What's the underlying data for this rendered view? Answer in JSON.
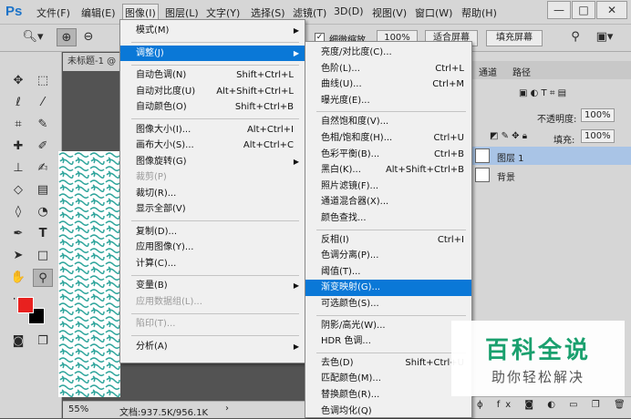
{
  "app": {
    "logo": "Ps"
  },
  "menubar": {
    "items": [
      "文件(F)",
      "编辑(E)",
      "图像(I)",
      "图层(L)",
      "文字(Y)",
      "选择(S)",
      "滤镜(T)",
      "3D(D)",
      "视图(V)",
      "窗口(W)",
      "帮助(H)"
    ],
    "active": "图像(I)"
  },
  "window": {
    "minimize": "—",
    "restore": "□",
    "close": "✕"
  },
  "options": {
    "checkbox_label": "细微缩放",
    "zoom": "100%",
    "fit_screen": "适合屏幕",
    "fill_screen": "填充屏幕"
  },
  "document": {
    "tab_title": "未标题-1 @",
    "zoom": "55%",
    "doc_size": "文档:937.5K/956.1K"
  },
  "image_menu": {
    "items": [
      {
        "label": "模式(M)",
        "sub": true
      },
      {
        "sep": true
      },
      {
        "label": "调整(J)",
        "sub": true,
        "hl": true
      },
      {
        "sep": true
      },
      {
        "label": "自动色调(N)",
        "sc": "Shift+Ctrl+L"
      },
      {
        "label": "自动对比度(U)",
        "sc": "Alt+Shift+Ctrl+L"
      },
      {
        "label": "自动颜色(O)",
        "sc": "Shift+Ctrl+B"
      },
      {
        "sep": true
      },
      {
        "label": "图像大小(I)...",
        "sc": "Alt+Ctrl+I"
      },
      {
        "label": "画布大小(S)...",
        "sc": "Alt+Ctrl+C"
      },
      {
        "label": "图像旋转(G)",
        "sub": true
      },
      {
        "label": "裁剪(P)",
        "dis": true
      },
      {
        "label": "裁切(R)..."
      },
      {
        "label": "显示全部(V)"
      },
      {
        "sep": true
      },
      {
        "label": "复制(D)..."
      },
      {
        "label": "应用图像(Y)..."
      },
      {
        "label": "计算(C)..."
      },
      {
        "sep": true
      },
      {
        "label": "变量(B)",
        "sub": true
      },
      {
        "label": "应用数据组(L)...",
        "dis": true
      },
      {
        "sep": true
      },
      {
        "label": "陷印(T)...",
        "dis": true
      },
      {
        "sep": true
      },
      {
        "label": "分析(A)",
        "sub": true
      }
    ]
  },
  "adjust_menu": {
    "items": [
      {
        "label": "亮度/对比度(C)..."
      },
      {
        "label": "色阶(L)...",
        "sc": "Ctrl+L"
      },
      {
        "label": "曲线(U)...",
        "sc": "Ctrl+M"
      },
      {
        "label": "曝光度(E)..."
      },
      {
        "sep": true
      },
      {
        "label": "自然饱和度(V)..."
      },
      {
        "label": "色相/饱和度(H)...",
        "sc": "Ctrl+U"
      },
      {
        "label": "色彩平衡(B)...",
        "sc": "Ctrl+B"
      },
      {
        "label": "黑白(K)...",
        "sc": "Alt+Shift+Ctrl+B"
      },
      {
        "label": "照片滤镜(F)..."
      },
      {
        "label": "通道混合器(X)..."
      },
      {
        "label": "颜色查找..."
      },
      {
        "sep": true
      },
      {
        "label": "反相(I)",
        "sc": "Ctrl+I"
      },
      {
        "label": "色调分离(P)..."
      },
      {
        "label": "阈值(T)..."
      },
      {
        "label": "渐变映射(G)...",
        "hl": true
      },
      {
        "label": "可选颜色(S)..."
      },
      {
        "sep": true
      },
      {
        "label": "阴影/高光(W)..."
      },
      {
        "label": "HDR 色调..."
      },
      {
        "sep": true
      },
      {
        "label": "去色(D)",
        "sc": "Shift+Ctrl+U"
      },
      {
        "label": "匹配颜色(M)..."
      },
      {
        "label": "替换颜色(R)..."
      },
      {
        "label": "色调均化(Q)"
      }
    ]
  },
  "panel": {
    "tabs": [
      "通道",
      "路径"
    ],
    "opacity_label": "不透明度:",
    "opacity": "100%",
    "lock_label": "锁定:",
    "fill_label": "填充:",
    "fill": "100%",
    "layers": [
      "图层 1",
      "背景"
    ]
  },
  "watermark": {
    "title": "百科全说",
    "subtitle": "助你轻松解决"
  },
  "colors": {
    "foreground": "#e8211f",
    "background": "#000000",
    "highlight": "#0a78d7",
    "accent_watermark": "#1aa06e"
  }
}
